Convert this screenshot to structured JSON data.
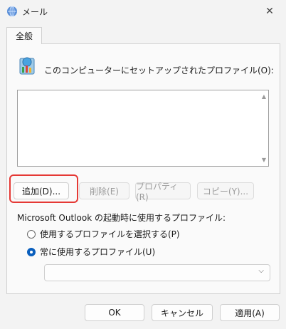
{
  "window": {
    "title": "メール",
    "close_glyph": "✕"
  },
  "tabs": [
    {
      "label": "全般",
      "selected": true
    }
  ],
  "profiles": {
    "label": "このコンピューターにセットアップされたプロファイル(O):",
    "items": [],
    "scroll_up_glyph": "▲",
    "scroll_down_glyph": "▼"
  },
  "buttons": {
    "add": "追加(D)...",
    "delete": "削除(E)",
    "properties": "プロパティ(R)",
    "copy": "コピー(Y)..."
  },
  "startup": {
    "label": "Microsoft Outlook の起動時に使用するプロファイル:",
    "option_prompt": "使用するプロファイルを選択する(P)",
    "option_always": "常に使用するプロファイル(U)",
    "selected": "option_always",
    "always_profile_value": "",
    "chevron_glyph": "⌵"
  },
  "footer": {
    "ok": "OK",
    "cancel": "キャンセル",
    "apply": "適用(A)"
  },
  "icons": {
    "title": "mail-globe-icon",
    "profiles": "mail-profiles-icon",
    "close": "close-icon",
    "chevron": "chevron-down-icon"
  },
  "colors": {
    "highlight_border": "#e53935",
    "radio_checked": "#0a5fbd",
    "disabled_text": "#9c9c9c"
  }
}
